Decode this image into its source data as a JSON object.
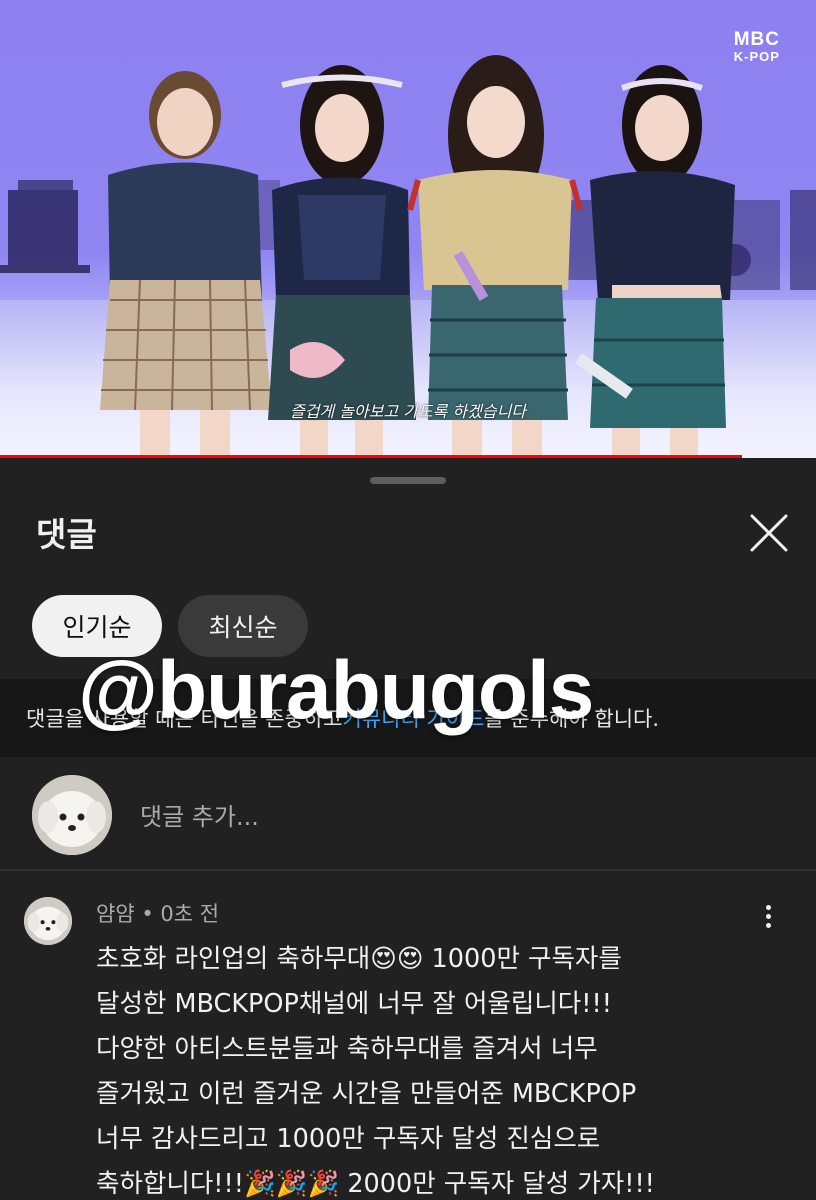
{
  "video": {
    "logo_line1": "MBC",
    "logo_line2": "K-POP",
    "subtitle": "즐겁게 놀아보고 가도록 하겠습니다",
    "progress_fraction": 0.909,
    "progress_color": "#ff0000"
  },
  "comments_panel": {
    "title": "댓글",
    "close_icon": "close-icon",
    "sort_chips": [
      {
        "label": "인기순",
        "selected": true
      },
      {
        "label": "최신순",
        "selected": false
      }
    ],
    "notice": {
      "text_before": "댓글을 사용할 때는 타인을 존중하고 ",
      "link": "커뮤니티 가이드",
      "text_after": "를 준수해야 합니다."
    },
    "watermark": "@burabugols",
    "add_comment_placeholder": "댓글 추가...",
    "comments": [
      {
        "author": "얌얌",
        "time": "0초 전",
        "separator": "•",
        "lines": [
          "초호화 라인업의 축하무대😍😍 1000만 구독자를",
          "달성한 MBCKPOP채널에 너무 잘 어울립니다!!!",
          "다양한 아티스트분들과 축하무대를 즐겨서 너무",
          "즐거웠고 이런 즐거운 시간을 만들어준 MBCKPOP",
          "너무 감사드리고 1000만 구독자 달성 진심으로",
          "축하합니다!!!🎉🎉🎉 2000만 구독자 달성 가자!!!"
        ]
      }
    ]
  },
  "colors": {
    "background": "#212121",
    "accent_link": "#3ea6ff",
    "chip_active_bg": "#f1f1f1",
    "chip_idle_bg": "#3a3a3a"
  }
}
